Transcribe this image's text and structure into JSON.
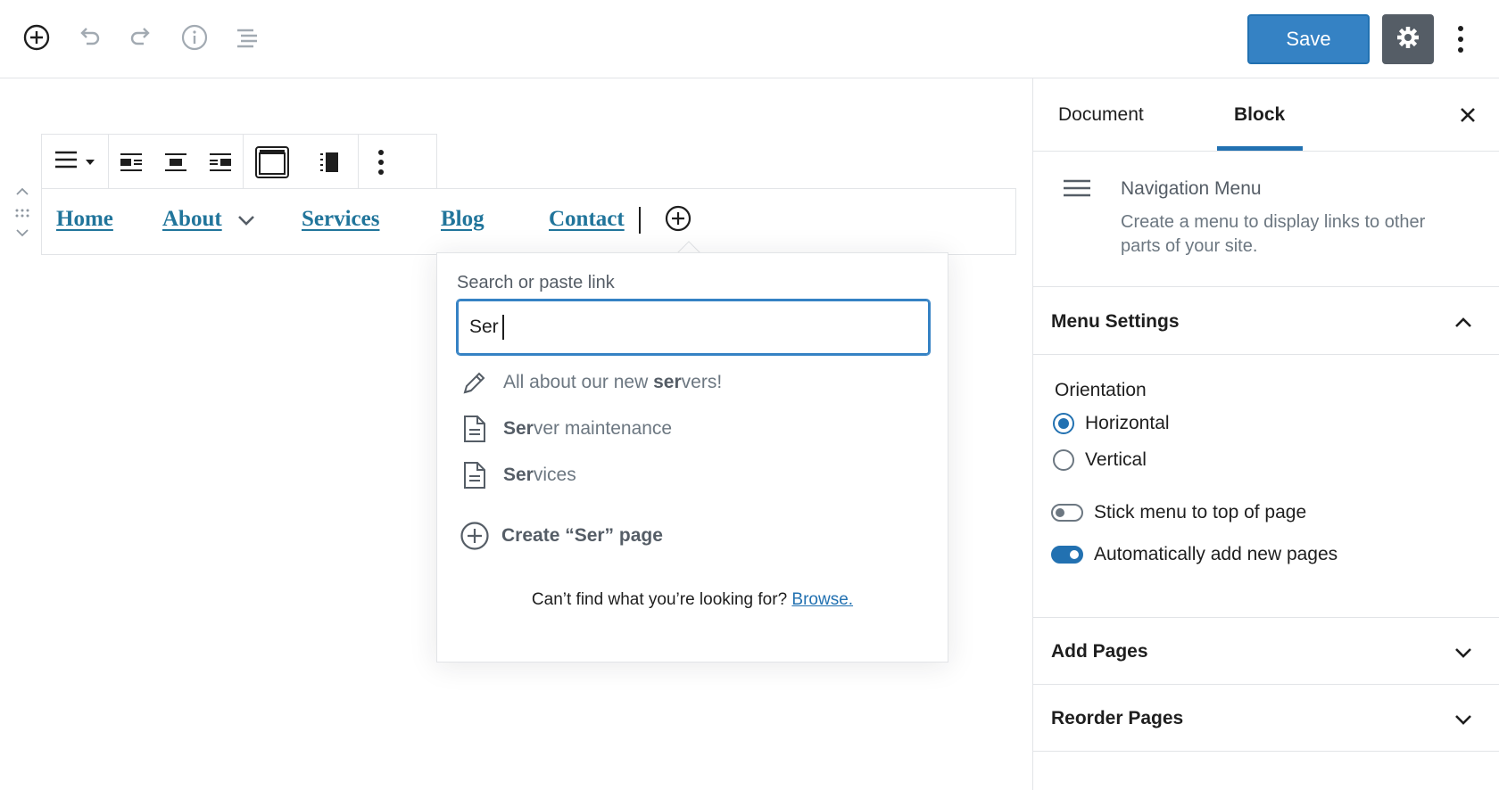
{
  "topbar": {
    "save_label": "Save",
    "icons": [
      "add-block-icon",
      "undo-icon",
      "redo-icon",
      "info-icon",
      "outline-icon",
      "gear-icon",
      "more-vertical-icon"
    ]
  },
  "nav": {
    "items": [
      {
        "label": "Home"
      },
      {
        "label": "About",
        "has_submenu": true
      },
      {
        "label": "Services"
      },
      {
        "label": "Blog"
      },
      {
        "label": "Contact"
      }
    ]
  },
  "link_popover": {
    "label": "Search or paste link",
    "input_value": "Ser",
    "suggestions": [
      {
        "prefix": "All about our new ",
        "match": "ser",
        "suffix": "vers!",
        "icon": "pencil-icon"
      },
      {
        "prefix": "",
        "match": "Ser",
        "suffix": "ver maintenance",
        "icon": "page-icon"
      },
      {
        "prefix": "",
        "match": "Ser",
        "suffix": "vices",
        "icon": "page-icon"
      }
    ],
    "create_label": "Create “Ser” page",
    "footer_text": "Can’t find what you’re looking for?",
    "footer_link": "Browse."
  },
  "sidebar": {
    "tabs": [
      {
        "label": "Document"
      },
      {
        "label": "Block",
        "active": true
      }
    ],
    "block": {
      "title": "Navigation Menu",
      "description": "Create a menu to display links to other parts of your site."
    },
    "menu_settings": {
      "title": "Menu Settings",
      "orientation_label": "Orientation",
      "orientation_options": [
        {
          "label": "Horizontal",
          "checked": true
        },
        {
          "label": "Vertical",
          "checked": false
        }
      ],
      "toggles": [
        {
          "label": "Stick menu to top of page",
          "on": false
        },
        {
          "label": "Automatically add new pages",
          "on": true
        }
      ]
    },
    "add_pages_title": "Add Pages",
    "reorder_pages_title": "Reorder Pages"
  },
  "colors": {
    "accent": "#2271b1",
    "link": "#21759b",
    "save_button": "#3582c4",
    "settings_button": "#555d66"
  }
}
